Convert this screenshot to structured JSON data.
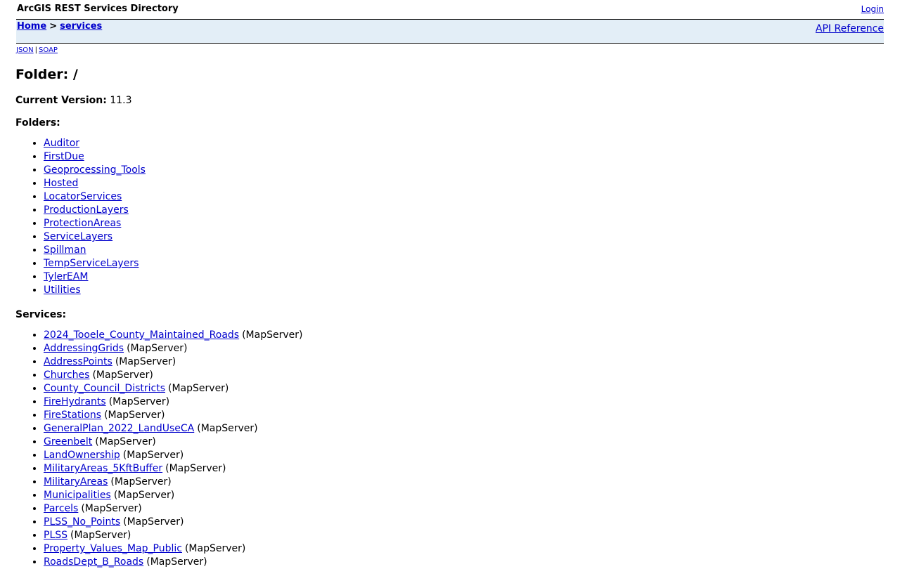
{
  "header": {
    "title": "ArcGIS REST Services Directory",
    "login_label": "Login"
  },
  "nav": {
    "breadcrumb_home": "Home",
    "breadcrumb_sep": ">",
    "breadcrumb_current": "services",
    "api_reference": "API Reference"
  },
  "formats": {
    "json": "JSON",
    "sep": "|",
    "soap": "SOAP"
  },
  "page": {
    "folder_title": "Folder: /",
    "version_label": "Current Version:",
    "version_value": "11.3",
    "folders_heading": "Folders:",
    "services_heading": "Services:"
  },
  "folders": [
    "Auditor",
    "FirstDue",
    "Geoprocessing_Tools",
    "Hosted",
    "LocatorServices",
    "ProductionLayers",
    "ProtectionAreas",
    "ServiceLayers",
    "Spillman",
    "TempServiceLayers",
    "TylerEAM",
    "Utilities"
  ],
  "services": [
    {
      "name": "2024_Tooele_County_Maintained_Roads",
      "type": "(MapServer)"
    },
    {
      "name": "AddressingGrids",
      "type": "(MapServer)"
    },
    {
      "name": "AddressPoints",
      "type": "(MapServer)"
    },
    {
      "name": "Churches",
      "type": "(MapServer)"
    },
    {
      "name": "County_Council_Districts",
      "type": "(MapServer)"
    },
    {
      "name": "FireHydrants",
      "type": "(MapServer)"
    },
    {
      "name": "FireStations",
      "type": "(MapServer)"
    },
    {
      "name": "GeneralPlan_2022_LandUseCA",
      "type": "(MapServer)"
    },
    {
      "name": "Greenbelt",
      "type": "(MapServer)"
    },
    {
      "name": "LandOwnership",
      "type": "(MapServer)"
    },
    {
      "name": "MilitaryAreas_5KftBuffer",
      "type": "(MapServer)"
    },
    {
      "name": "MilitaryAreas",
      "type": "(MapServer)"
    },
    {
      "name": "Municipalities",
      "type": "(MapServer)"
    },
    {
      "name": "Parcels",
      "type": "(MapServer)"
    },
    {
      "name": "PLSS_No_Points",
      "type": "(MapServer)"
    },
    {
      "name": "PLSS",
      "type": "(MapServer)"
    },
    {
      "name": "Property_Values_Map_Public",
      "type": "(MapServer)"
    },
    {
      "name": "RoadsDept_B_Roads",
      "type": "(MapServer)"
    }
  ]
}
